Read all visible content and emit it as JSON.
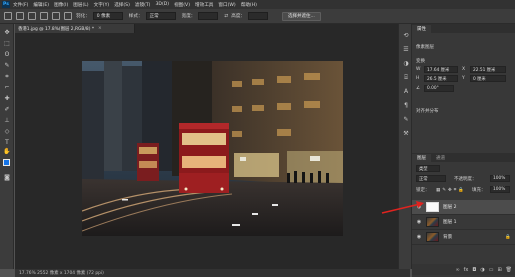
{
  "menubar": {
    "items": [
      "文件(F)",
      "编辑(E)",
      "图像(I)",
      "图层(L)",
      "文字(Y)",
      "选择(S)",
      "滤镜(T)",
      "3D(D)",
      "视图(V)",
      "增效工具",
      "窗口(W)",
      "帮助(H)"
    ]
  },
  "options": {
    "feather_label": "羽化：",
    "feather_value": "0 像素",
    "style_label": "样式：",
    "style_value": "正常",
    "width_label": "宽度：",
    "height_label": "高度：",
    "select_mask_button": "选择并遮住..."
  },
  "document": {
    "tab_title": "香港1.jpg @ 17.8%(图层 2,RGB/8) *",
    "status": "17.76%    2552 像素 x 1704 像素 (72 ppi)"
  },
  "properties": {
    "tab_label": "属性",
    "section_label": "像素图层",
    "transform_label": "变换",
    "w_value": "17.64 厘米",
    "h_value": "26.5 厘米",
    "x_value": "22.51 厘米",
    "y_value": "0 厘米",
    "angle_value": "0.00°",
    "align_label": "对齐并分布"
  },
  "layers": {
    "tabs": [
      "图层",
      "通道"
    ],
    "kind_label": "类型",
    "mode_value": "正常",
    "opacity_label": "不透明度：",
    "opacity_value": "100%",
    "lock_label": "锁定：",
    "fill_label": "填充：",
    "fill_value": "100%",
    "items": [
      {
        "name": "图层 2",
        "thumb": "white",
        "selected": true
      },
      {
        "name": "图层 1",
        "thumb": "photo",
        "selected": false
      },
      {
        "name": "背景",
        "thumb": "photo",
        "selected": false
      }
    ]
  },
  "colors": {
    "foreground": "#1473e6",
    "background": "#ffffff",
    "annotation_arrow": "#e0231f"
  }
}
